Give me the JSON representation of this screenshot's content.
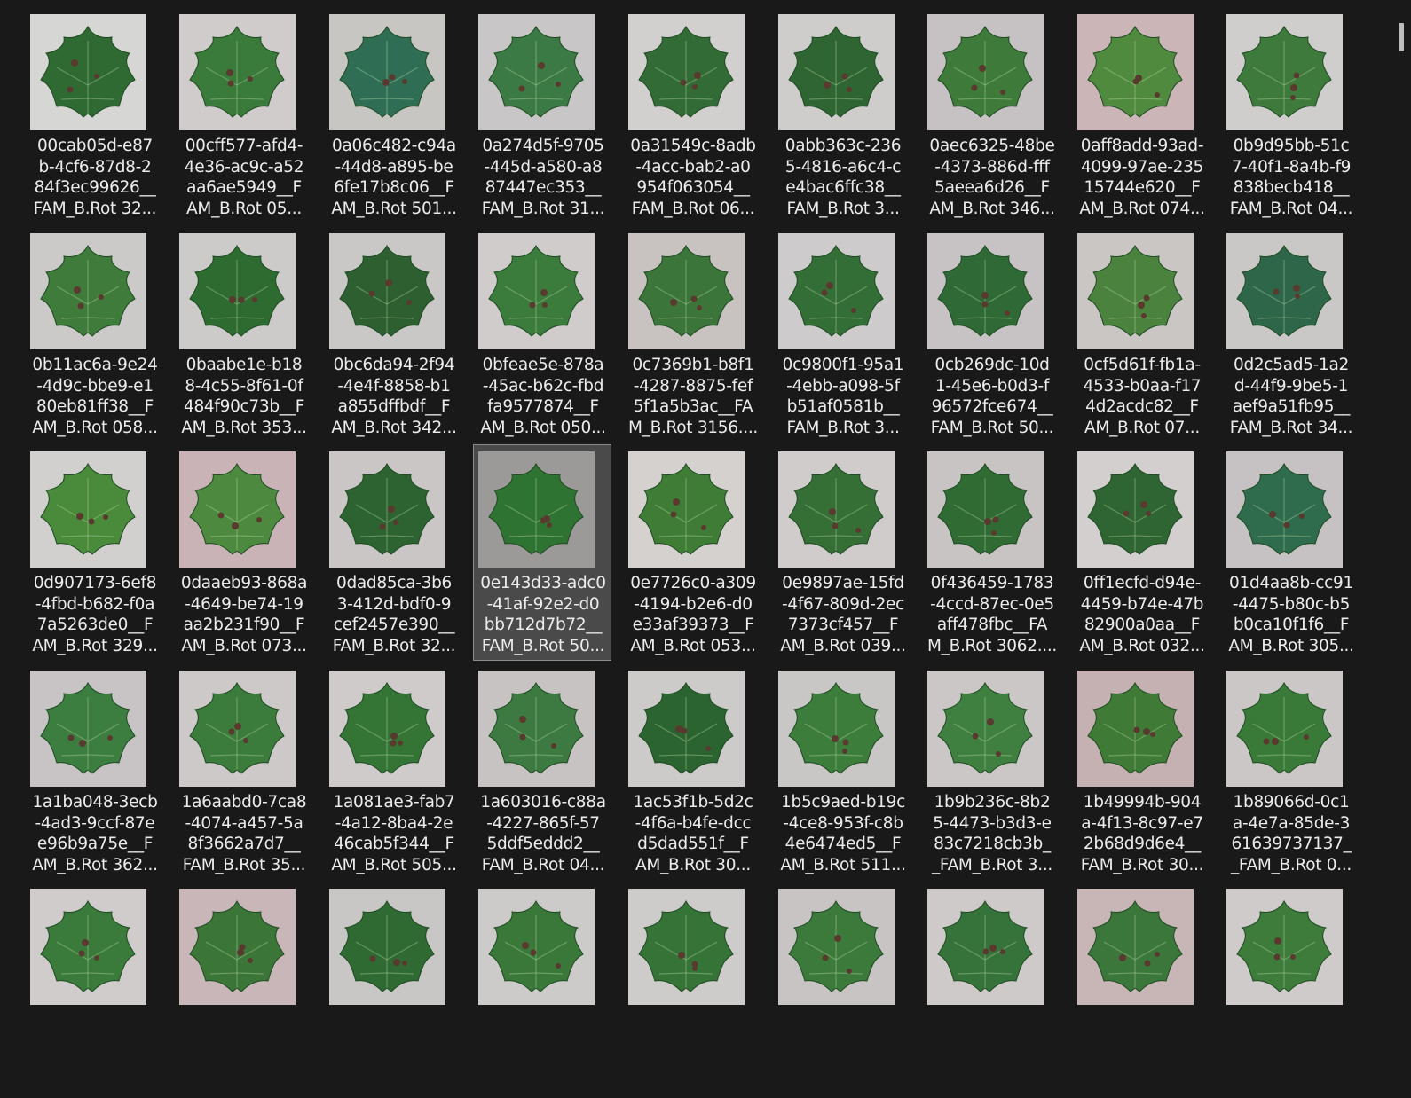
{
  "files": [
    {
      "lines": [
        "00cab05d-e87",
        "b-4cf6-87d8-2",
        "84f3ec99626__",
        "FAM_B.Rot 32..."
      ],
      "bg": "#d6d6d4",
      "leaf": "#2f6a33"
    },
    {
      "lines": [
        "00cff577-afd4-",
        "4e36-ac9c-a52",
        "aa6ae5949__F",
        "AM_B.Rot 05..."
      ],
      "bg": "#cfcccb",
      "leaf": "#3a7a3a"
    },
    {
      "lines": [
        "0a06c482-c94a",
        "-44d8-a895-be",
        "6fe17b8c06__F",
        "AM_B.Rot 501..."
      ],
      "bg": "#c8c6c3",
      "leaf": "#2f6e55"
    },
    {
      "lines": [
        "0a274d5f-9705",
        "-445d-a580-a8",
        "87447ec353__",
        "FAM_B.Rot 31..."
      ],
      "bg": "#c9c6c7",
      "leaf": "#3b7a44"
    },
    {
      "lines": [
        "0a31549c-8adb",
        "-4acc-bab2-a0",
        "954f063054__",
        "FAM_B.Rot 06..."
      ],
      "bg": "#d2cfcf",
      "leaf": "#336b36"
    },
    {
      "lines": [
        "0abb363c-236",
        "5-4816-a6c4-c",
        "e4bac6ffc38__",
        "FAM_B.Rot 3..."
      ],
      "bg": "#cfcdcc",
      "leaf": "#2f6532"
    },
    {
      "lines": [
        "0aec6325-48be",
        "-4373-886d-fff",
        "5aeea6d26__F",
        "AM_B.Rot 346..."
      ],
      "bg": "#c6c2c3",
      "leaf": "#3e7b3b"
    },
    {
      "lines": [
        "0aff8add-93ad-",
        "4099-97ae-235",
        "15744e620__F",
        "AM_B.Rot 074..."
      ],
      "bg": "#cbb5b7",
      "leaf": "#4f8a3e"
    },
    {
      "lines": [
        "0b9d95bb-51c",
        "7-40f1-8a4b-f9",
        "838becb418__",
        "FAM_B.Rot 04..."
      ],
      "bg": "#d0cdcd",
      "leaf": "#3e7a3c"
    },
    {
      "lines": [
        "0b11ac6a-9e24",
        "-4d9c-bbe9-e1",
        "80eb81ff38__F",
        "AM_B.Rot 058..."
      ],
      "bg": "#cbcac8",
      "leaf": "#3f7b3a"
    },
    {
      "lines": [
        "0baabe1e-b18",
        "8-4c55-8f61-0f",
        "484f90c73b__F",
        "AM_B.Rot 353..."
      ],
      "bg": "#cdcbc9",
      "leaf": "#2e6b30"
    },
    {
      "lines": [
        "0bc6da94-2f94",
        "-4e4f-8858-b1",
        "a855dffbdf__F",
        "AM_B.Rot 342..."
      ],
      "bg": "#c9c8c6",
      "leaf": "#2d5f30"
    },
    {
      "lines": [
        "0bfeae5e-878a",
        "-45ac-b62c-fbd",
        "fa9577874__F",
        "AM_B.Rot 050..."
      ],
      "bg": "#cfcccb",
      "leaf": "#3b7b3c"
    },
    {
      "lines": [
        "0c7369b1-b8f1",
        "-4287-8875-fef",
        "5f1a5b3ac__FA",
        "M_B.Rot 3156...."
      ],
      "bg": "#c8c2c1",
      "leaf": "#3c753a"
    },
    {
      "lines": [
        "0c9800f1-95a1",
        "-4ebb-a098-5f",
        "b51af0581b__",
        "FAM_B.Rot 3..."
      ],
      "bg": "#cdcbcb",
      "leaf": "#336e37"
    },
    {
      "lines": [
        "0cb269dc-10d",
        "1-45e6-b0d3-f",
        "96572fce674__",
        "FAM_B.Rot 50..."
      ],
      "bg": "#c7c3c4",
      "leaf": "#2f6a36"
    },
    {
      "lines": [
        "0cf5d61f-fb1a-",
        "4533-b0aa-f17",
        "4d2acdc82__F",
        "AM_B.Rot 07..."
      ],
      "bg": "#c9c6c4",
      "leaf": "#4a823e"
    },
    {
      "lines": [
        "0d2c5ad5-1a2",
        "d-44f9-9be5-1",
        "aef9a51fb95__",
        "FAM_B.Rot 34..."
      ],
      "bg": "#cac8c7",
      "leaf": "#2e664a"
    },
    {
      "lines": [
        "0d907173-6ef8",
        "-4fbd-b682-f0a",
        "7a5263de0__F",
        "AM_B.Rot 329..."
      ],
      "bg": "#d2d0ce",
      "leaf": "#4a8a3b"
    },
    {
      "lines": [
        "0daaeb93-868a",
        "-4649-be74-19",
        "aa2b231f90__F",
        "AM_B.Rot 073..."
      ],
      "bg": "#cab3b6",
      "leaf": "#4d8a3f"
    },
    {
      "lines": [
        "0dad85ca-3b6",
        "3-412d-bdf0-9",
        "cef2457e390__",
        "FAM_B.Rot 32..."
      ],
      "bg": "#c9c6c5",
      "leaf": "#2c6331"
    },
    {
      "lines": [
        "0e143d33-adc0",
        "-41af-92e2-d0",
        "bb712d7b72__",
        "FAM_B.Rot 50..."
      ],
      "bg": "#9c9a99",
      "leaf": "#2f7332"
    },
    {
      "lines": [
        "0e7726c0-a309",
        "-4194-b2e6-d0",
        "e33af39373__F",
        "AM_B.Rot 053..."
      ],
      "bg": "#d4d1cf",
      "leaf": "#3f7d37"
    },
    {
      "lines": [
        "0e9897ae-15fd",
        "-4f67-809d-2ec",
        "7373cf457__F",
        "AM_B.Rot 039..."
      ],
      "bg": "#cfcccb",
      "leaf": "#356f36"
    },
    {
      "lines": [
        "0f436459-1783",
        "-4ccd-87ec-0e5",
        "aff478fbc__FA",
        "M_B.Rot 3062...."
      ],
      "bg": "#c8c4c4",
      "leaf": "#2f6b33"
    },
    {
      "lines": [
        "0ff1ecfd-d94e-",
        "4459-b74e-47b",
        "82900a0aa__F",
        "AM_B.Rot 032..."
      ],
      "bg": "#d2cfce",
      "leaf": "#2e6532"
    },
    {
      "lines": [
        "01d4aa8b-cc91",
        "-4475-b80c-b5",
        "b0ca10f1f6__F",
        "AM_B.Rot 305..."
      ],
      "bg": "#c6c2c4",
      "leaf": "#2f6c4e"
    },
    {
      "lines": [
        "1a1ba048-3ecb",
        "-4ad3-9ccf-87e",
        "e96b9a75e__F",
        "AM_B.Rot 362..."
      ],
      "bg": "#c8c4c5",
      "leaf": "#3c7d40"
    },
    {
      "lines": [
        "1a6aabd0-7ca8",
        "-4074-a457-5a",
        "8f3662a7d7__",
        "FAM_B.Rot 35..."
      ],
      "bg": "#ccc9c8",
      "leaf": "#3b7b3b"
    },
    {
      "lines": [
        "1a081ae3-fab7",
        "-4a12-8ba4-2e",
        "46cab5f344__F",
        "AM_B.Rot 505..."
      ],
      "bg": "#cecbca",
      "leaf": "#347536"
    },
    {
      "lines": [
        "1a603016-c88a",
        "-4227-865f-57",
        "5ddf5eddd2__",
        "FAM_B.Rot 04..."
      ],
      "bg": "#c7c3c2",
      "leaf": "#3c7a42"
    },
    {
      "lines": [
        "1ac53f1b-5d2c",
        "-4f6a-b4fe-dcc",
        "d5dad551f__F",
        "AM_B.Rot 30..."
      ],
      "bg": "#cdcbca",
      "leaf": "#2c6431"
    },
    {
      "lines": [
        "1b5c9aed-b19c",
        "-4ce8-953f-c8b",
        "4e6474ed5__F",
        "AM_B.Rot 511..."
      ],
      "bg": "#c9c7c6",
      "leaf": "#3d7d3c"
    },
    {
      "lines": [
        "1b9b236c-8b2",
        "5-4473-b3d3-e",
        "83c7218cb3b_",
        "_FAM_B.Rot 3..."
      ],
      "bg": "#cac7c6",
      "leaf": "#3f8040"
    },
    {
      "lines": [
        "1b49994b-904",
        "a-4f13-8c97-e7",
        "2b68d9d6e4__",
        "FAM_B.Rot 30..."
      ],
      "bg": "#c5b0b2",
      "leaf": "#3f7a36"
    },
    {
      "lines": [
        "1b89066d-0c1",
        "a-4e7a-85de-3",
        "61639737137_",
        "_FAM_B.Rot 0..."
      ],
      "bg": "#cbc7c6",
      "leaf": "#3a7a38"
    },
    {
      "lines": [
        "",
        "",
        "",
        ""
      ],
      "bg": "#cfcccb",
      "leaf": "#3a7a3a"
    },
    {
      "lines": [
        "",
        "",
        "",
        ""
      ],
      "bg": "#c9b6b8",
      "leaf": "#3b7638"
    },
    {
      "lines": [
        "",
        "",
        "",
        ""
      ],
      "bg": "#c9c7c6",
      "leaf": "#2f6a33"
    },
    {
      "lines": [
        "",
        "",
        "",
        ""
      ],
      "bg": "#cdcbca",
      "leaf": "#3a783a"
    },
    {
      "lines": [
        "",
        "",
        "",
        ""
      ],
      "bg": "#cecccb",
      "leaf": "#357337"
    },
    {
      "lines": [
        "",
        "",
        "",
        ""
      ],
      "bg": "#c8c4c4",
      "leaf": "#3c7a3b"
    },
    {
      "lines": [
        "",
        "",
        "",
        ""
      ],
      "bg": "#cdcac9",
      "leaf": "#36733a"
    },
    {
      "lines": [
        "",
        "",
        "",
        ""
      ],
      "bg": "#c8b5b6",
      "leaf": "#3b773a"
    },
    {
      "lines": [
        "",
        "",
        "",
        ""
      ],
      "bg": "#cecbca",
      "leaf": "#3e7c3c"
    }
  ],
  "selected_index": 21
}
